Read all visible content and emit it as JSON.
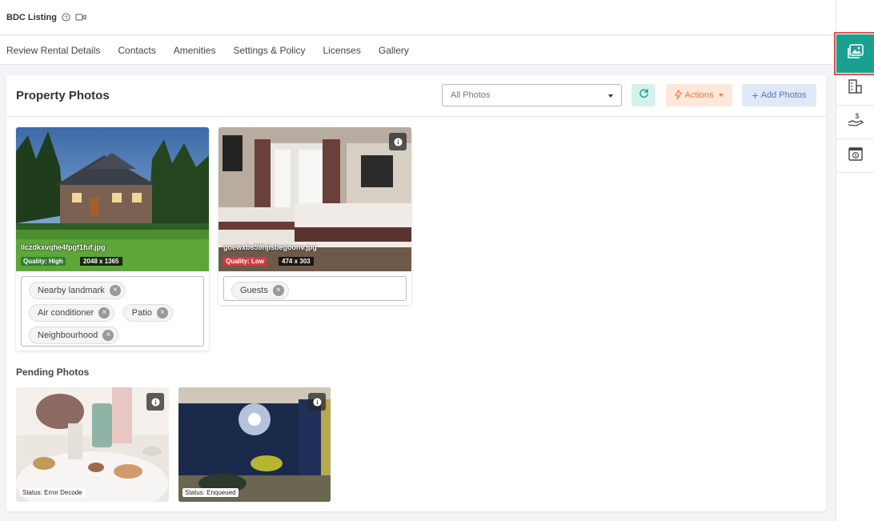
{
  "header": {
    "title": "BDC Listing",
    "help_icon": "help-circle-icon",
    "video_icon": "video-camera-icon"
  },
  "tabs": [
    {
      "label": "Review Rental Details"
    },
    {
      "label": "Contacts"
    },
    {
      "label": "Amenities"
    },
    {
      "label": "Settings & Policy"
    },
    {
      "label": "Licenses"
    },
    {
      "label": "Gallery"
    }
  ],
  "right_sidebar": {
    "items": [
      {
        "icon": "photo-gallery-icon",
        "active": true
      },
      {
        "icon": "building-icon"
      },
      {
        "icon": "hand-dollar-icon"
      },
      {
        "icon": "calendar-dollar-icon"
      }
    ]
  },
  "property_photos": {
    "title": "Property Photos",
    "filter": {
      "selected": "All Photos"
    },
    "actions_label": "Actions",
    "add_label": "Add Photos",
    "photos": [
      {
        "filename": "ilczdkxvqhe4fpgf1fuf.jpg",
        "quality": "Quality: High",
        "dimensions": "2048 x 1365",
        "tags": [
          "Nearby landmark",
          "Air conditioner",
          "Patio",
          "Neighbourhood"
        ]
      },
      {
        "filename": "goewxbs59hjisbegoonv.jpg",
        "quality": "Quality: Low",
        "dimensions": "474 x 303",
        "tags": [
          "Guests"
        ]
      }
    ]
  },
  "pending_photos": {
    "title": "Pending Photos",
    "items": [
      {
        "status": "Status: Error Decode"
      },
      {
        "status": "Status: Enqueued"
      }
    ]
  },
  "colors": {
    "accent": "#1aa090",
    "quality_high": "#2e7d32",
    "quality_low": "#d9363e",
    "actions": "#f07a3a",
    "add": "#4b7bc4"
  }
}
